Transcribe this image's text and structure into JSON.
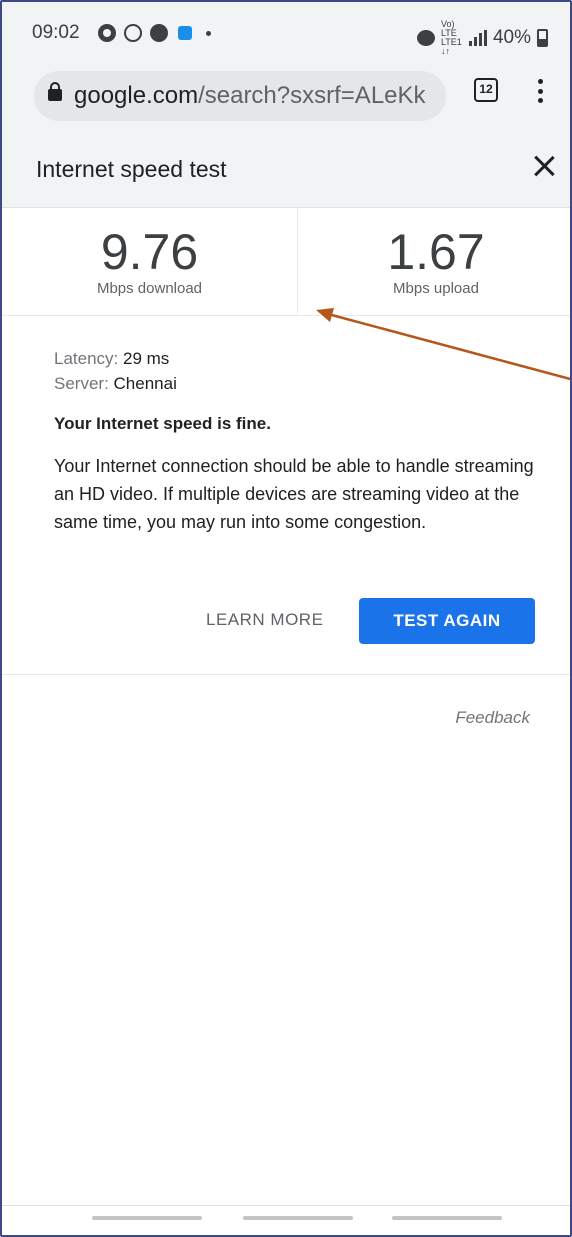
{
  "status_bar": {
    "time": "09:02",
    "volte": "Vo) LTE LTE1 ↓↑",
    "battery": "40%",
    "icons": [
      "chrome-icon",
      "whatsapp-icon",
      "jio-icon",
      "bag-icon",
      "dot-icon",
      "alarm-icon",
      "signal-icon",
      "battery-icon"
    ]
  },
  "browser": {
    "url_domain": "google.com",
    "url_rest": "/search?sxsrf=ALeKk",
    "tab_count": "12"
  },
  "card": {
    "title": "Internet speed test",
    "download": {
      "value": "9.76",
      "label": "Mbps download"
    },
    "upload": {
      "value": "1.67",
      "label": "Mbps upload"
    },
    "latency_label": "Latency: ",
    "latency_value": "29 ms",
    "server_label": "Server: ",
    "server_value": "Chennai",
    "verdict": "Your Internet speed is fine.",
    "description": "Your Internet connection should be able to handle streaming an HD video. If multiple devices are streaming video at the same time, you may run into some congestion.",
    "learn_more": "LEARN MORE",
    "test_again": "TEST AGAIN",
    "feedback": "Feedback"
  },
  "colors": {
    "accent": "#1a73e8",
    "annotation_arrow": "#b5561a",
    "frame_border": "#3c4a8a"
  }
}
